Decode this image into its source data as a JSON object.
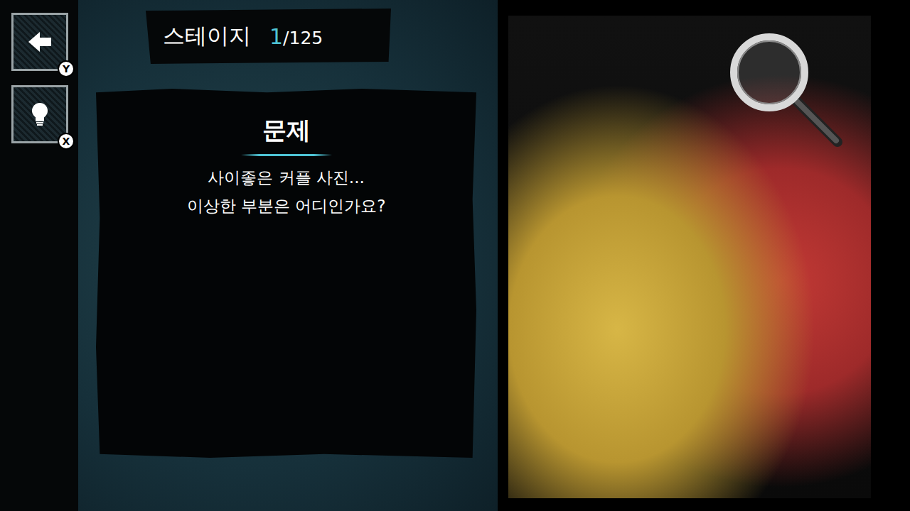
{
  "header": {
    "label": "스테이지",
    "current": "1",
    "total": "/125"
  },
  "buttons": [
    {
      "key": "Y"
    },
    {
      "key": "X"
    }
  ],
  "question": {
    "title": "문제",
    "lines": [
      "사이좋은 커플 사진...",
      "이상한 부분은 어디인가요?"
    ]
  }
}
